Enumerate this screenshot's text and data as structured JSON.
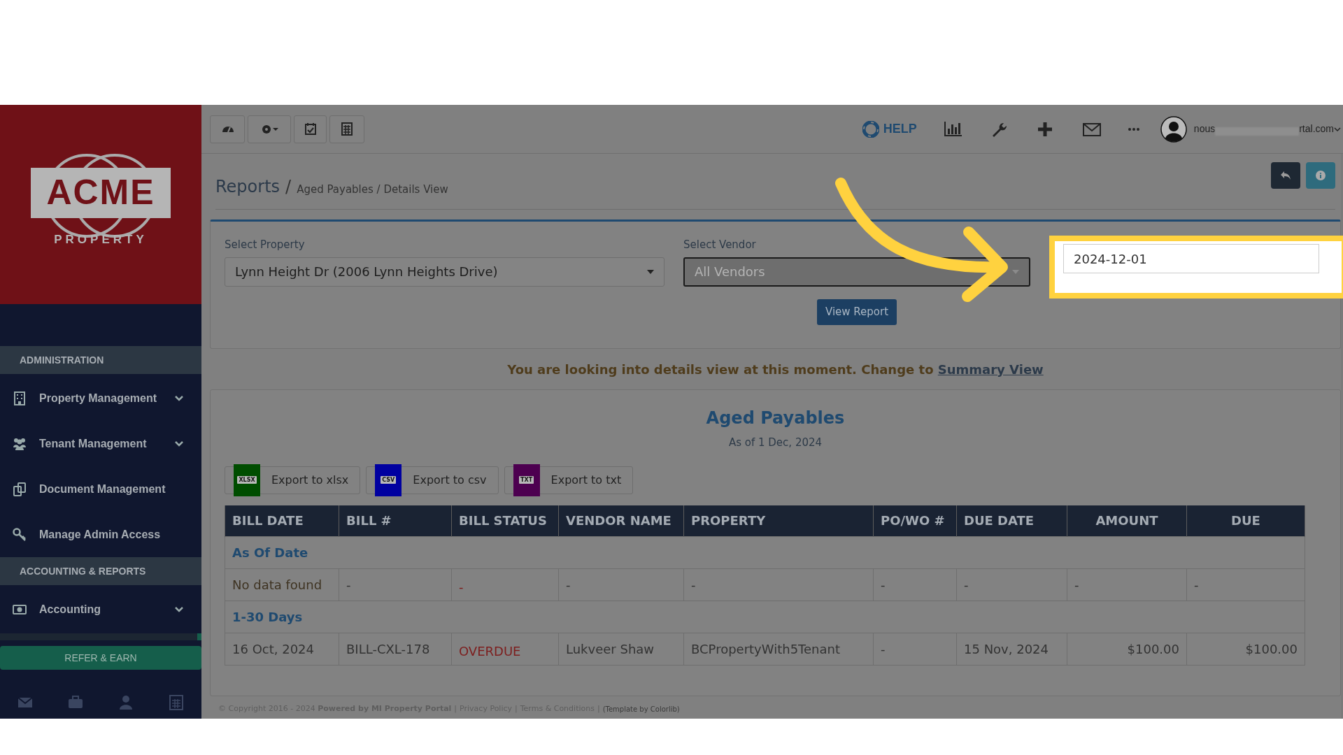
{
  "sidebar": {
    "logo": {
      "word": "ACME",
      "tagline": "PROPERTY"
    },
    "sections": [
      {
        "heading": "ADMINISTRATION",
        "items": [
          {
            "label": "Property Management",
            "has_submenu": true
          },
          {
            "label": "Tenant Management",
            "has_submenu": true
          },
          {
            "label": "Document Management",
            "has_submenu": false
          },
          {
            "label": "Manage Admin Access",
            "has_submenu": false
          }
        ]
      },
      {
        "heading": "ACCOUNTING & REPORTS",
        "items": [
          {
            "label": "Accounting",
            "has_submenu": true
          }
        ]
      }
    ],
    "refer_button": "REFER & EARN"
  },
  "topbar": {
    "help": "HELP",
    "user_email_parts": [
      "nous",
      "rtal.com"
    ]
  },
  "breadcrumb": {
    "title": "Reports",
    "separator": "/",
    "trail": "Aged Payables / Details View"
  },
  "filters": {
    "property": {
      "label": "Select Property",
      "value": "Lynn Height Dr (2006 Lynn Heights Drive)"
    },
    "vendor": {
      "label": "Select Vendor",
      "placeholder": "All Vendors"
    },
    "as_of": {
      "value": "2024-12-01",
      "highlighted": true
    },
    "submit": "View Report"
  },
  "notice": {
    "text": "You are looking into details view at this moment. Change to ",
    "link": "Summary View"
  },
  "report": {
    "title": "Aged Payables",
    "subtitle": "As of 1 Dec, 2024",
    "exports": [
      {
        "label": "Export to xlsx",
        "badge": "XLSX",
        "color": "#004d00"
      },
      {
        "label": "Export to csv",
        "badge": "CSV",
        "color": "#0000a0"
      },
      {
        "label": "Export to txt",
        "badge": "TXT",
        "color": "#4d0050"
      }
    ],
    "columns": [
      "BILL DATE",
      "BILL #",
      "BILL STATUS",
      "VENDOR NAME",
      "PROPERTY",
      "PO/WO #",
      "DUE DATE",
      "AMOUNT",
      "DUE"
    ],
    "rows": [
      {
        "kind": "group",
        "label": "As Of Date"
      },
      {
        "kind": "data",
        "cells": [
          "No data found",
          "-",
          "-",
          "-",
          "-",
          "-",
          "-",
          "-",
          "-"
        ]
      },
      {
        "kind": "group",
        "label": "1-30 Days"
      },
      {
        "kind": "data",
        "cells": [
          "16 Oct, 2024",
          "BILL-CXL-178",
          "OVERDUE",
          "Lukveer Shaw",
          "BCPropertyWith5Tenant",
          "-",
          "15 Nov, 2024",
          "$100.00",
          "$100.00"
        ]
      }
    ]
  },
  "footer": [
    {
      "kind": "text",
      "text": "© Copyright 2016 - 2024 **Powered by MI Property Portal**"
    },
    {
      "kind": "separator",
      "text": "|"
    },
    {
      "kind": "link",
      "text": "Privacy Policy"
    },
    {
      "kind": "separator",
      "text": "|"
    },
    {
      "kind": "link",
      "text": "Terms & Conditions"
    },
    {
      "kind": "separator",
      "text": "|"
    },
    {
      "kind": "credit",
      "text": "(Template by Colorlib)"
    }
  ]
}
